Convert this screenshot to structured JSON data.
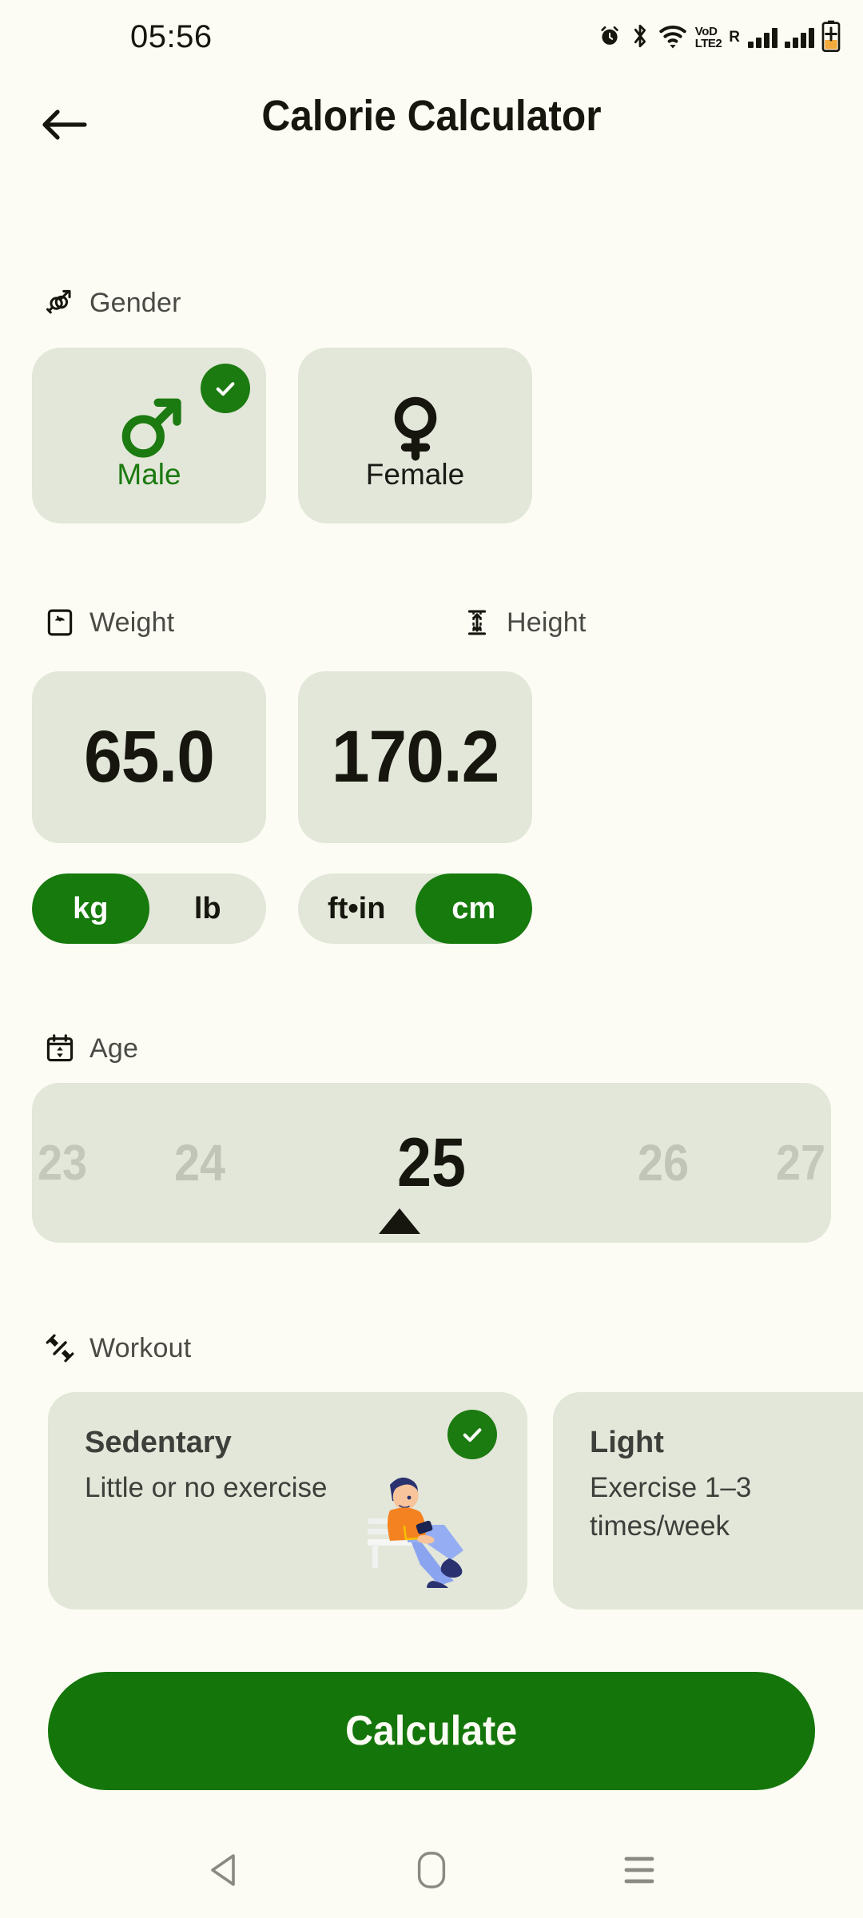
{
  "status_bar": {
    "time": "05:56",
    "icons": [
      "alarm-icon",
      "bluetooth-icon",
      "wifi-icon",
      "volte-icon",
      "signal-icon",
      "signal-icon",
      "battery-charging-icon"
    ],
    "volte_line1": "VoD",
    "volte_line2": "LTE2",
    "roaming": "R"
  },
  "appbar": {
    "back_icon": "arrow-left-icon",
    "title": "Calorie Calculator"
  },
  "gender": {
    "label": "Gender",
    "icon": "gender-icon",
    "options": [
      {
        "label": "Male",
        "symbol": "mars-icon",
        "selected": true
      },
      {
        "label": "Female",
        "symbol": "venus-icon",
        "selected": false
      }
    ]
  },
  "weight": {
    "label": "Weight",
    "icon": "scale-icon",
    "value": "65.0",
    "units": [
      {
        "label": "kg",
        "selected": true
      },
      {
        "label": "lb",
        "selected": false
      }
    ]
  },
  "height": {
    "label": "Height",
    "icon": "height-icon",
    "value": "170.2",
    "units": [
      {
        "label": "ft•in",
        "selected": false
      },
      {
        "label": "cm",
        "selected": true
      }
    ]
  },
  "age": {
    "label": "Age",
    "icon": "calendar-stepper-icon",
    "values": [
      "23",
      "24",
      "25",
      "26",
      "27"
    ],
    "selected": "25",
    "selected_index": 2
  },
  "workout": {
    "label": "Workout",
    "icon": "dumbbell-icon",
    "options": [
      {
        "title": "Sedentary",
        "desc": "Little or no exercise",
        "selected": true,
        "illustration": "person-sitting-with-phone"
      },
      {
        "title": "Light",
        "desc": "Exercise 1–3 times/week",
        "selected": false,
        "illustration": ""
      }
    ]
  },
  "calculate": {
    "label": "Calculate"
  },
  "navbar": {
    "back": "nav-back-icon",
    "home": "nav-home-icon",
    "recents": "nav-recents-icon"
  },
  "colors": {
    "background": "#fcfcf4",
    "card": "#e2e7d9",
    "accent_green": "#167a0c",
    "text_dark": "#16160f",
    "text_muted": "#4a4a45"
  }
}
